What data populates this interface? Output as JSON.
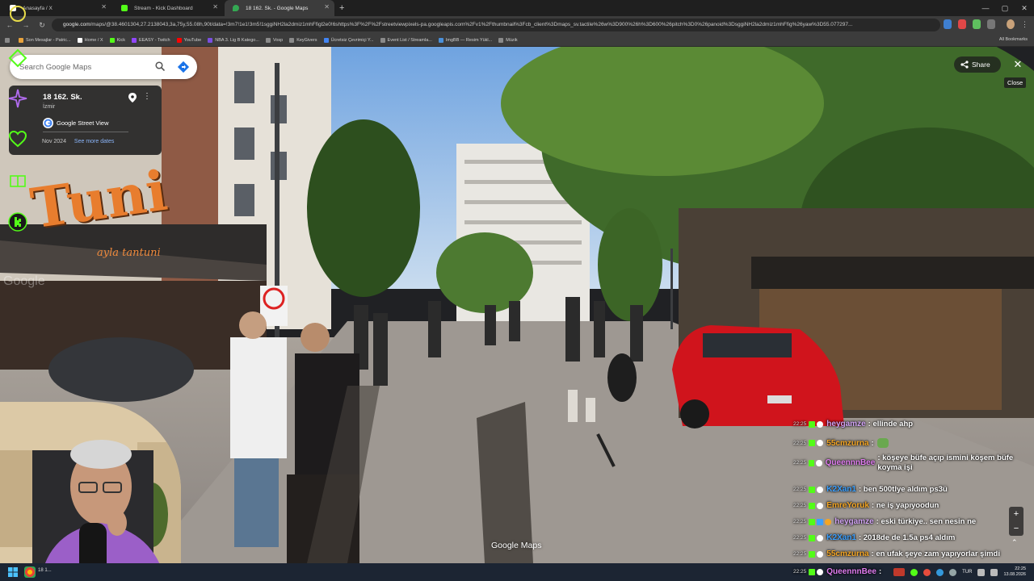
{
  "browser": {
    "tabs": [
      {
        "title": "Anasayfa / X",
        "favicon_color": "#ffffff"
      },
      {
        "title": "Stream - Kick Dashboard",
        "favicon_color": "#53fc18"
      },
      {
        "title": "18 162. Sk. - Google Maps",
        "favicon_color": "#34a853"
      }
    ],
    "new_tab_label": "+",
    "address_host": "google.com",
    "address_rest": "/maps/@38.4601304,27.2138043,3a,75y,55.08h,90t/data=!3m7!1e1!3m5!1sggiNH2la2dmiz1mhFfigl2e0!6shttps%3F%2F%2Fstreetviewpixels-pa.googleapis.com%2Fv1%2Fthumbnail%3Fcb_client%3Dmaps_sv.tactile%26w%3D900%26h%3D600%26pitch%3D0%26panoid%3DsggiNH2la2dmiz1mhFfig%26yaw%3D55.077297...",
    "bookmarks": [
      {
        "label": "Son Mesajlar - Patric...",
        "color": "#e8a33d"
      },
      {
        "label": "Home / X",
        "color": "#ffffff"
      },
      {
        "label": "Kick",
        "color": "#53fc18"
      },
      {
        "label": "EEASY - Twitch",
        "color": "#9146ff"
      },
      {
        "label": "YouTube",
        "color": "#ff0000"
      },
      {
        "label": "NBA 3. Lig B Katego...",
        "color": "#7a4fe0"
      },
      {
        "label": "Vosp",
        "color": "#8a8a8a"
      },
      {
        "label": "KeyGivers",
        "color": "#8a8a8a"
      },
      {
        "label": "Ücretsiz Çevrimiçi Y...",
        "color": "#4285f4"
      },
      {
        "label": "Event List / Streamla...",
        "color": "#8a8a8a"
      },
      {
        "label": "ImgBB — Resim Yükl...",
        "color": "#4a90d9"
      },
      {
        "label": "Müzik",
        "color": "#8a8a8a"
      }
    ],
    "all_bookmarks": "All Bookmarks"
  },
  "maps": {
    "search_placeholder": "Search Google Maps",
    "place_name": "18 162. Sk.",
    "city": "İzmir",
    "source": "Google Street View",
    "capture_date": "Nov 2024",
    "see_more_dates": "See more dates",
    "share_label": "Share",
    "close_tooltip": "Close",
    "close_glyph": "✕",
    "watermark": "Google Maps",
    "zoom_in": "+",
    "zoom_out": "−"
  },
  "scene_text": {
    "shop_sign": "Tuni",
    "shop_awning": "ayla tantuni",
    "google_watermark": "Google"
  },
  "chat": {
    "messages": [
      {
        "time": "22:25",
        "user": "heygamze",
        "color": "#d2a4f5",
        "msg": ": ellinde ahp"
      },
      {
        "time": "22:25",
        "user": "55cmzurna",
        "color": "#f5a623",
        "msg": ":"
      },
      {
        "time": "22:25",
        "user": "QueennnBee",
        "color": "#e07cf0",
        "msg": ": köşeye büfe açıp ismini köşem büfe koyma işi"
      },
      {
        "time": "22:25",
        "user": "K2Xan1",
        "color": "#3aa0ff",
        "msg": ": ben 500tlye aldım ps3ü"
      },
      {
        "time": "22:25",
        "user": "EmreYoruk",
        "color": "#f5a623",
        "msg": ": ne iş yapıyoodun"
      },
      {
        "time": "22:25",
        "user": "heygamze",
        "color": "#d2a4f5",
        "msg": ": eski türkiye.. sen nesin ne"
      },
      {
        "time": "22:25",
        "user": "K2Xan1",
        "color": "#3aa0ff",
        "msg": ": 2018de de 1.5a ps4 aldım"
      },
      {
        "time": "22:25",
        "user": "55cmzurna",
        "color": "#f5a623",
        "msg": ": en ufak şeye zam yapıyorlar şimdi"
      },
      {
        "time": "22:25",
        "user": "QueennnBee",
        "color": "#e07cf0",
        "msg": ":"
      }
    ]
  },
  "taskbar": {
    "app_label": "18 1...",
    "lang": "TUR",
    "time": "22:25",
    "date": "13.08.2026"
  },
  "colors": {
    "kick_green": "#53fc18",
    "maps_blue": "#8ab4f8",
    "car_red": "#d0141c"
  }
}
